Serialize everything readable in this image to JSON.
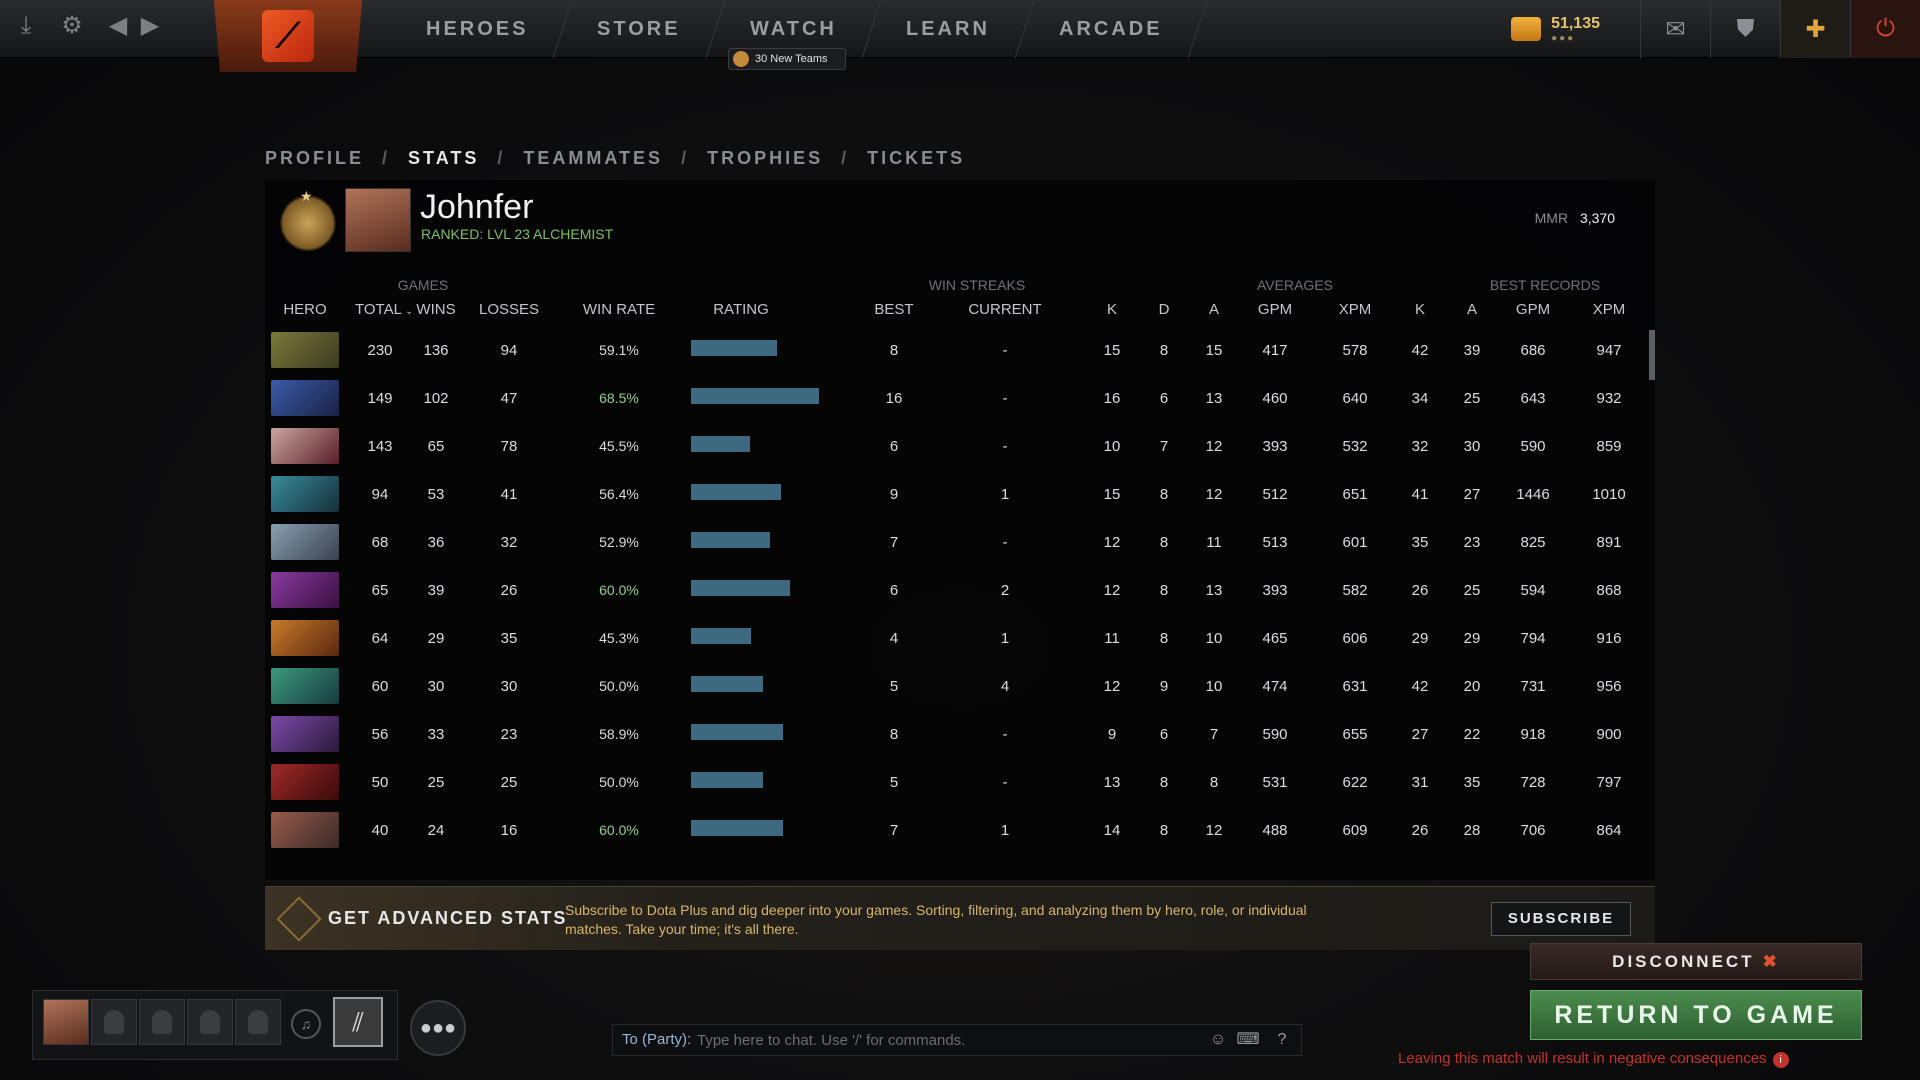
{
  "topbar": {
    "nav": [
      "HEROES",
      "STORE",
      "WATCH",
      "LEARN",
      "ARCADE"
    ],
    "watch_badge": "30 New Teams",
    "shards": "51,135"
  },
  "profile_tabs": [
    "PROFILE",
    "STATS",
    "TEAMMATES",
    "TROPHIES",
    "TICKETS"
  ],
  "player": {
    "name": "Johnfer",
    "subtitle": "RANKED: LVL 23 ALCHEMIST",
    "mmr_label": "MMR",
    "mmr_value": "3,370"
  },
  "table": {
    "groups": {
      "games": "GAMES",
      "win_streaks": "WIN STREAKS",
      "averages": "AVERAGES",
      "best_records": "BEST RECORDS"
    },
    "columns": {
      "hero": "HERO",
      "total": "TOTAL",
      "wins": "WINS",
      "losses": "LOSSES",
      "win_rate": "WIN RATE",
      "rating": "RATING",
      "best": "BEST",
      "current": "CURRENT",
      "k": "K",
      "d": "D",
      "a": "A",
      "gpm": "GPM",
      "xpm": "XPM",
      "best_k": "K",
      "best_a": "A",
      "best_gpm": "GPM",
      "best_xpm": "XPM"
    },
    "rows": [
      {
        "total": "230",
        "wins": "136",
        "losses": "94",
        "win_rate": "59.1%",
        "rating": 0.67,
        "best": "8",
        "current": "-",
        "k": "15",
        "d": "8",
        "a": "15",
        "gpm": "417",
        "xpm": "578",
        "bk": "42",
        "ba": "39",
        "bgpm": "686",
        "bxpm": "947",
        "c1": "#7a7a3a",
        "c2": "#3c3a22"
      },
      {
        "total": "149",
        "wins": "102",
        "losses": "47",
        "win_rate": "68.5%",
        "rating": 1.0,
        "best": "16",
        "current": "-",
        "k": "16",
        "d": "6",
        "a": "13",
        "gpm": "460",
        "xpm": "640",
        "bk": "34",
        "ba": "25",
        "bgpm": "643",
        "bxpm": "932",
        "c1": "#3c5aa8",
        "c2": "#1a2344"
      },
      {
        "total": "143",
        "wins": "65",
        "losses": "78",
        "win_rate": "45.5%",
        "rating": 0.46,
        "best": "6",
        "current": "-",
        "k": "10",
        "d": "7",
        "a": "12",
        "gpm": "393",
        "xpm": "532",
        "bk": "32",
        "ba": "30",
        "bgpm": "590",
        "bxpm": "859",
        "c1": "#c9a6a0",
        "c2": "#5a1e2a"
      },
      {
        "total": "94",
        "wins": "53",
        "losses": "41",
        "win_rate": "56.4%",
        "rating": 0.7,
        "best": "9",
        "current": "1",
        "k": "15",
        "d": "8",
        "a": "12",
        "gpm": "512",
        "xpm": "651",
        "bk": "41",
        "ba": "27",
        "bgpm": "1446",
        "bxpm": "1010",
        "c1": "#3a8a9a",
        "c2": "#14303a"
      },
      {
        "total": "68",
        "wins": "36",
        "losses": "32",
        "win_rate": "52.9%",
        "rating": 0.62,
        "best": "7",
        "current": "-",
        "k": "12",
        "d": "8",
        "a": "11",
        "gpm": "513",
        "xpm": "601",
        "bk": "35",
        "ba": "23",
        "bgpm": "825",
        "bxpm": "891",
        "c1": "#8aa0b0",
        "c2": "#3a4050"
      },
      {
        "total": "65",
        "wins": "39",
        "losses": "26",
        "win_rate": "60.0%",
        "rating": 0.77,
        "best": "6",
        "current": "2",
        "k": "12",
        "d": "8",
        "a": "13",
        "gpm": "393",
        "xpm": "582",
        "bk": "26",
        "ba": "25",
        "bgpm": "594",
        "bxpm": "868",
        "c1": "#8a3aa0",
        "c2": "#3a1040"
      },
      {
        "total": "64",
        "wins": "29",
        "losses": "35",
        "win_rate": "45.3%",
        "rating": 0.47,
        "best": "4",
        "current": "1",
        "k": "11",
        "d": "8",
        "a": "10",
        "gpm": "465",
        "xpm": "606",
        "bk": "29",
        "ba": "29",
        "bgpm": "794",
        "bxpm": "916",
        "c1": "#c87a2a",
        "c2": "#5a2810"
      },
      {
        "total": "60",
        "wins": "30",
        "losses": "30",
        "win_rate": "50.0%",
        "rating": 0.56,
        "best": "5",
        "current": "4",
        "k": "12",
        "d": "9",
        "a": "10",
        "gpm": "474",
        "xpm": "631",
        "bk": "42",
        "ba": "20",
        "bgpm": "731",
        "bxpm": "956",
        "c1": "#3a9a7a",
        "c2": "#1a3a40"
      },
      {
        "total": "56",
        "wins": "33",
        "losses": "23",
        "win_rate": "58.9%",
        "rating": 0.72,
        "best": "8",
        "current": "-",
        "k": "9",
        "d": "6",
        "a": "7",
        "gpm": "590",
        "xpm": "655",
        "bk": "27",
        "ba": "22",
        "bgpm": "918",
        "bxpm": "900",
        "c1": "#7a4aa8",
        "c2": "#2a1a3a"
      },
      {
        "total": "50",
        "wins": "25",
        "losses": "25",
        "win_rate": "50.0%",
        "rating": 0.56,
        "best": "5",
        "current": "-",
        "k": "13",
        "d": "8",
        "a": "8",
        "gpm": "531",
        "xpm": "622",
        "bk": "31",
        "ba": "35",
        "bgpm": "728",
        "bxpm": "797",
        "c1": "#a02a2a",
        "c2": "#3a0a0a"
      },
      {
        "total": "40",
        "wins": "24",
        "losses": "16",
        "win_rate": "60.0%",
        "rating": 0.72,
        "best": "7",
        "current": "1",
        "k": "14",
        "d": "8",
        "a": "12",
        "gpm": "488",
        "xpm": "609",
        "bk": "26",
        "ba": "28",
        "bgpm": "706",
        "bxpm": "864",
        "c1": "#9a5a4a",
        "c2": "#3a2a2a"
      }
    ]
  },
  "banner": {
    "title": "GET ADVANCED STATS",
    "text": "Subscribe to Dota Plus and dig deeper into your games. Sorting, filtering, and analyzing them by hero, role, or individual matches. Take your time; it's all there.",
    "button": "SUBSCRIBE"
  },
  "chat": {
    "to_label": "To (Party):",
    "placeholder": "Type here to chat. Use '/' for commands."
  },
  "actions": {
    "disconnect": "DISCONNECT",
    "return": "RETURN TO GAME",
    "warning": "Leaving this match will result in negative consequences"
  },
  "colors": {
    "accent_green": "#4b8c4e",
    "warning_red": "#c2342b",
    "rating_bar": "#3d6a80",
    "winrate_green": "#8fd08a"
  }
}
